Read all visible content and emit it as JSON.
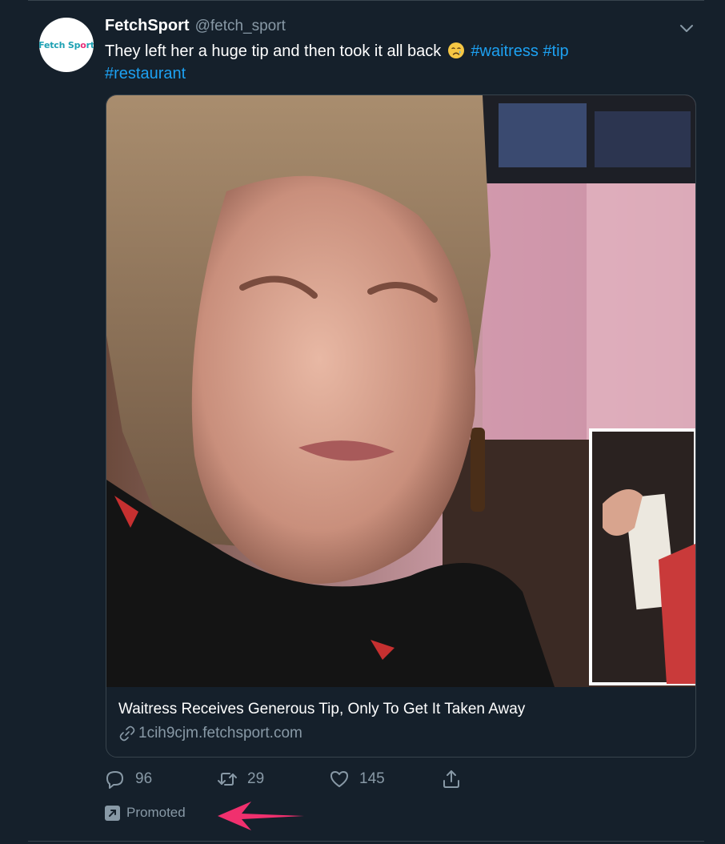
{
  "account": {
    "avatar_text_main": "Fetch Sp",
    "avatar_text_accent": "o",
    "avatar_text_end": "rt",
    "display_name": "FetchSport",
    "handle": "@fetch_sport"
  },
  "tweet": {
    "text": "They left her a huge tip and then took it all back",
    "emoji": "crying-face",
    "hashtags": [
      "#waitress",
      "#tip",
      "#restaurant"
    ]
  },
  "card": {
    "title": "Waitress Receives Generous Tip, Only To Get It Taken Away",
    "link": "1cih9cjm.fetchsport.com"
  },
  "actions": {
    "replies": "96",
    "retweets": "29",
    "likes": "145"
  },
  "promoted_label": "Promoted",
  "colors": {
    "background": "#15202b",
    "hashtag": "#1da1f2",
    "secondary_text": "#8899a6",
    "border": "#38444d",
    "annotation_arrow": "#f0306e"
  }
}
